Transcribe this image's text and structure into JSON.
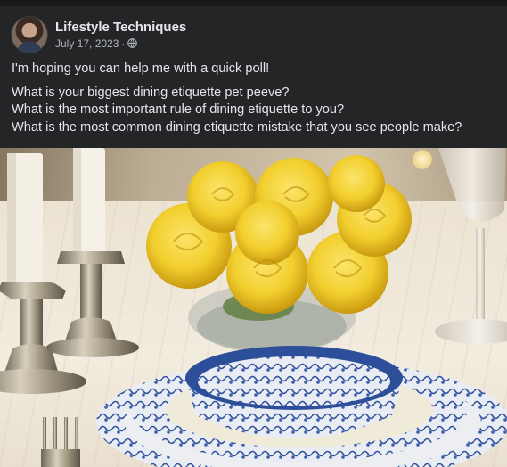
{
  "post": {
    "author": "Lifestyle Techniques",
    "date": "July 17, 2023",
    "separator": "·",
    "privacy_icon": "globe-icon",
    "paragraphs": [
      "I'm hoping you can help me with a quick poll!",
      "What is your biggest dining etiquette pet peeve?",
      "What is the most important rule of dining etiquette to you?",
      "What is the most common dining etiquette mistake that you see people make?"
    ]
  },
  "photo": {
    "alt_icon": "table-setting-photo"
  },
  "colors": {
    "background": "#242526",
    "text": "#e4e6eb",
    "secondary_text": "#b0b3b8",
    "rose_yellow": "#f2cf2e",
    "china_blue": "#2d4f9a"
  }
}
